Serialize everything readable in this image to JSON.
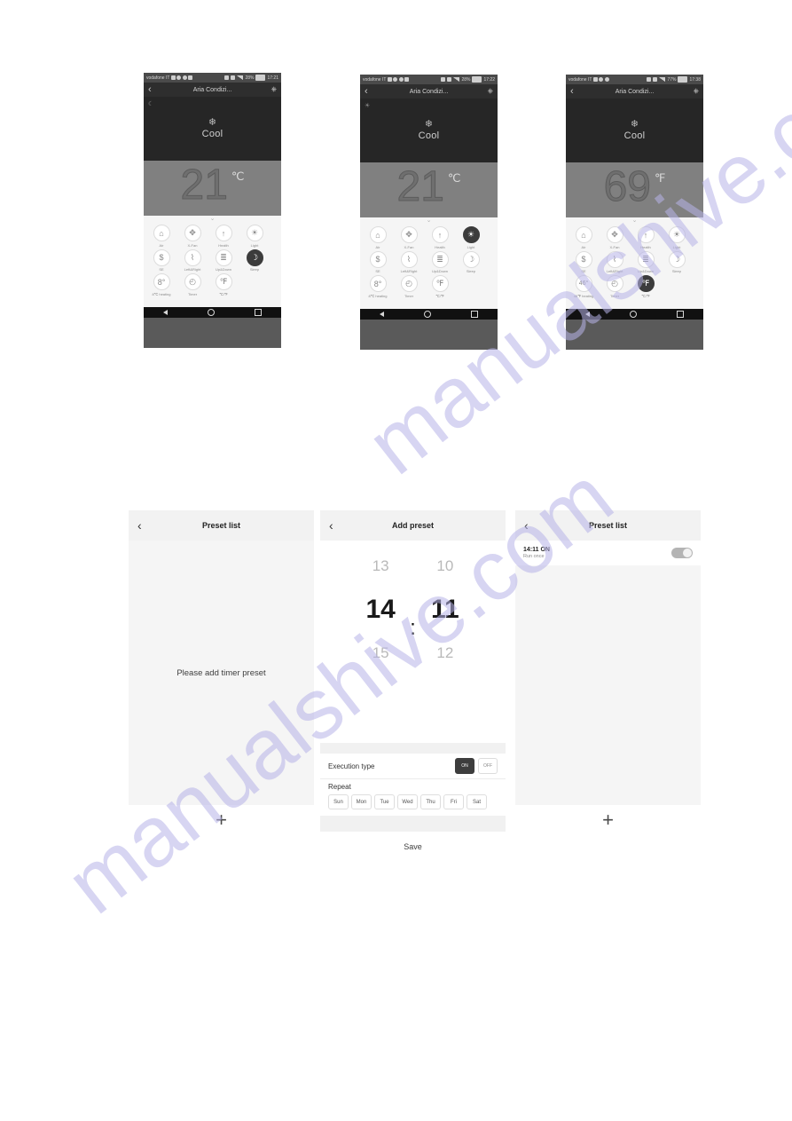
{
  "watermark": {
    "line1": "manualshive.com",
    "line2": "manualshive.com"
  },
  "phones": [
    {
      "id": "phone-celsius-sleep",
      "statusbar": {
        "carrier": "vodafone IT",
        "battery": "28%",
        "time": "17:21"
      },
      "appbar": {
        "back_icon": "chevron-left-icon",
        "title": "Aria Condizi...",
        "edit_icon": "pencil-icon",
        "power_icon": "power-icon"
      },
      "hero": {
        "corner_icon": "moon-icon",
        "mode_icon": "snowflake-icon",
        "mode_label": "Cool",
        "temperature": "21",
        "unit": "℃"
      },
      "chevron": "⌄",
      "buttons": [
        {
          "label": "Air",
          "icon": "air-house-icon",
          "glyph": "⌂",
          "active": false
        },
        {
          "label": "X-Fan",
          "icon": "fan-icon",
          "glyph": "✥",
          "active": false
        },
        {
          "label": "Health",
          "icon": "health-tree-icon",
          "glyph": "↑",
          "active": false
        },
        {
          "label": "Light",
          "icon": "light-bulb-icon",
          "glyph": "☀",
          "active": false
        },
        {
          "label": "SE",
          "icon": "energy-saving-icon",
          "glyph": "$",
          "active": false
        },
        {
          "label": "Left&Right",
          "icon": "swing-horizontal-icon",
          "glyph": "⌇",
          "active": false
        },
        {
          "label": "Up&Down",
          "icon": "swing-vertical-icon",
          "glyph": "≣",
          "active": false
        },
        {
          "label": "Sleep",
          "icon": "moon-icon",
          "glyph": "☽",
          "active": true
        },
        {
          "label": "8℃ heating",
          "icon": "eight-degree-icon",
          "glyph": "8°",
          "active": false
        },
        {
          "label": "Timer",
          "icon": "clock-icon",
          "glyph": "◴",
          "active": false
        },
        {
          "label": "℃/℉",
          "icon": "temperature-unit-icon",
          "glyph": "℉",
          "active": false
        }
      ],
      "navbar": {
        "back": "nav-back-icon",
        "home": "nav-home-icon",
        "recents": "nav-recents-icon"
      }
    },
    {
      "id": "phone-celsius-light",
      "statusbar": {
        "carrier": "vodafone IT",
        "battery": "28%",
        "time": "17:22"
      },
      "appbar": {
        "back_icon": "chevron-left-icon",
        "title": "Aria Condizi...",
        "edit_icon": "pencil-icon",
        "power_icon": "power-icon"
      },
      "hero": {
        "corner_icon": "light-bulb-icon",
        "mode_icon": "snowflake-icon",
        "mode_label": "Cool",
        "temperature": "21",
        "unit": "℃"
      },
      "chevron": "⌄",
      "buttons": [
        {
          "label": "Air",
          "icon": "air-house-icon",
          "glyph": "⌂",
          "active": false
        },
        {
          "label": "X-Fan",
          "icon": "fan-icon",
          "glyph": "✥",
          "active": false
        },
        {
          "label": "Health",
          "icon": "health-tree-icon",
          "glyph": "↑",
          "active": false
        },
        {
          "label": "Light",
          "icon": "light-bulb-icon",
          "glyph": "☀",
          "active": true
        },
        {
          "label": "SE",
          "icon": "energy-saving-icon",
          "glyph": "$",
          "active": false
        },
        {
          "label": "Left&Right",
          "icon": "swing-horizontal-icon",
          "glyph": "⌇",
          "active": false
        },
        {
          "label": "Up&Down",
          "icon": "swing-vertical-icon",
          "glyph": "≣",
          "active": false
        },
        {
          "label": "Sleep",
          "icon": "moon-icon",
          "glyph": "☽",
          "active": false
        },
        {
          "label": "8℃ heating",
          "icon": "eight-degree-icon",
          "glyph": "8°",
          "active": false
        },
        {
          "label": "Timer",
          "icon": "clock-icon",
          "glyph": "◴",
          "active": false
        },
        {
          "label": "℃/℉",
          "icon": "temperature-unit-icon",
          "glyph": "℉",
          "active": false
        }
      ],
      "navbar": {
        "back": "nav-back-icon",
        "home": "nav-home-icon",
        "recents": "nav-recents-icon"
      }
    },
    {
      "id": "phone-fahrenheit",
      "statusbar": {
        "carrier": "vodafone IT",
        "battery": "77%",
        "time": "17:38"
      },
      "appbar": {
        "back_icon": "chevron-left-icon",
        "title": "Aria Condizi...",
        "edit_icon": "pencil-icon",
        "power_icon": "power-icon"
      },
      "hero": {
        "corner_icon": "",
        "mode_icon": "snowflake-icon",
        "mode_label": "Cool",
        "temperature": "69",
        "unit": "℉"
      },
      "chevron": "⌄",
      "buttons": [
        {
          "label": "Air",
          "icon": "air-house-icon",
          "glyph": "⌂",
          "active": false
        },
        {
          "label": "X-Fan",
          "icon": "fan-icon",
          "glyph": "✥",
          "active": false
        },
        {
          "label": "Health",
          "icon": "health-tree-icon",
          "glyph": "↑",
          "active": false
        },
        {
          "label": "Light",
          "icon": "light-bulb-icon",
          "glyph": "☀",
          "active": false
        },
        {
          "label": "SE",
          "icon": "energy-saving-icon",
          "glyph": "$",
          "active": false
        },
        {
          "label": "Left&Right",
          "icon": "swing-horizontal-icon",
          "glyph": "⌇",
          "active": false
        },
        {
          "label": "Up&Down",
          "icon": "swing-vertical-icon",
          "glyph": "≣",
          "active": false
        },
        {
          "label": "Sleep",
          "icon": "moon-icon",
          "glyph": "☽",
          "active": false
        },
        {
          "label": "46℉ heating",
          "icon": "forty-six-degree-icon",
          "glyph": "46°",
          "active": false
        },
        {
          "label": "Timer",
          "icon": "clock-icon",
          "glyph": "◴",
          "active": false
        },
        {
          "label": "℃/℉",
          "icon": "temperature-unit-icon",
          "glyph": "℉",
          "active": true
        }
      ],
      "navbar": {
        "back": "nav-back-icon",
        "home": "nav-home-icon",
        "recents": "nav-recents-icon"
      }
    }
  ],
  "preset_empty": {
    "header": {
      "back_icon": "chevron-left-icon",
      "title": "Preset list"
    },
    "empty_message": "Please add timer preset",
    "add_label": "+"
  },
  "add_preset": {
    "header": {
      "back_icon": "chevron-left-icon",
      "title": "Add preset"
    },
    "picker": {
      "hour_prev": "13",
      "hour_selected": "14",
      "hour_next": "15",
      "separator": ":",
      "minute_prev": "10",
      "minute_selected": "11",
      "minute_next": "12"
    },
    "execution": {
      "label": "Execution type",
      "options": [
        {
          "label": "ON",
          "selected": true
        },
        {
          "label": "OFF",
          "selected": false
        }
      ]
    },
    "repeat": {
      "label": "Repeat",
      "days": [
        "Sun",
        "Mon",
        "Tue",
        "Wed",
        "Thu",
        "Fri",
        "Sat"
      ]
    },
    "save_label": "Save"
  },
  "preset_list": {
    "header": {
      "back_icon": "chevron-left-icon",
      "title": "Preset list"
    },
    "items": [
      {
        "time": "14:11  ON",
        "subtitle": "Run once",
        "enabled": true
      }
    ],
    "add_label": "+"
  }
}
